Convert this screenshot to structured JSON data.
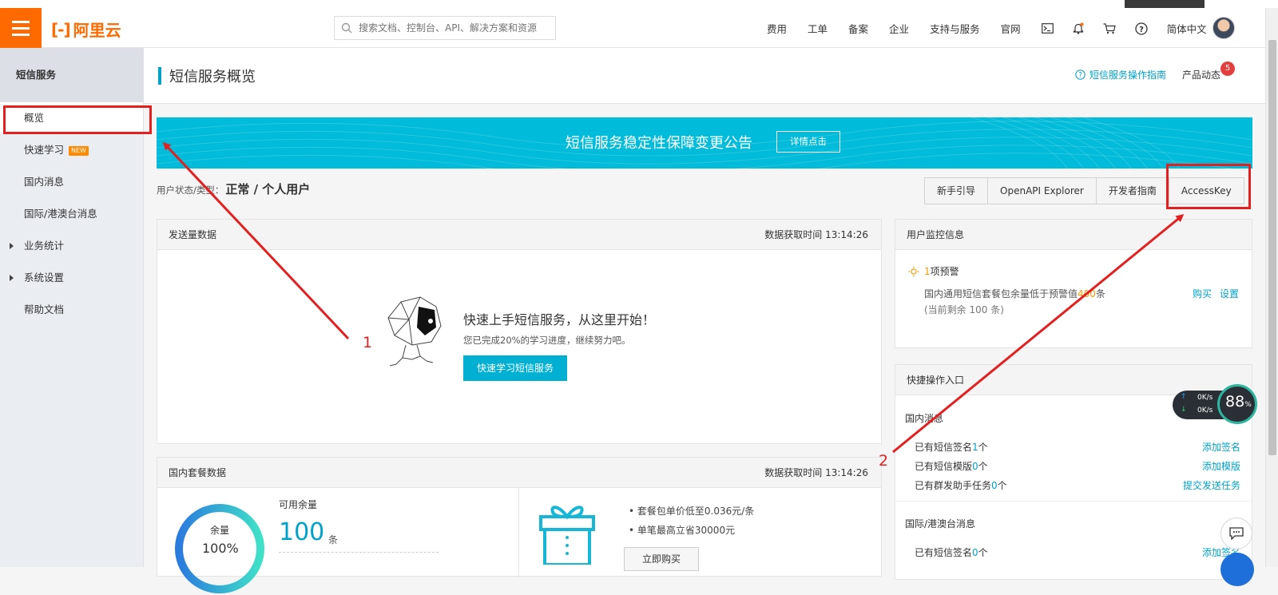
{
  "top": {
    "logo_text": "阿里云",
    "search_placeholder": "搜索文档、控制台、API、解决方案和资源",
    "nav": [
      "费用",
      "工单",
      "备案",
      "企业",
      "支持与服务",
      "官网"
    ],
    "lang": "简体中文"
  },
  "sidebar": {
    "title": "短信服务",
    "items": [
      {
        "label": "概览",
        "active": true
      },
      {
        "label": "快速学习",
        "badge": "NEW"
      },
      {
        "label": "国内消息"
      },
      {
        "label": "国际/港澳台消息"
      },
      {
        "label": "业务统计",
        "expandable": true
      },
      {
        "label": "系统设置",
        "expandable": true
      },
      {
        "label": "帮助文档"
      }
    ]
  },
  "header": {
    "title": "短信服务概览",
    "guide_link": "短信服务操作指南",
    "news_label": "产品动态",
    "news_count": "5"
  },
  "banner": {
    "text": "短信服务稳定性保障变更公告",
    "button": "详情点击"
  },
  "user_status": {
    "label": "用户状态/类型：",
    "value": "正常 / 个人用户"
  },
  "toolbar": [
    "新手引导",
    "OpenAPI Explorer",
    "开发者指南",
    "AccessKey"
  ],
  "send_panel": {
    "title": "发送量数据",
    "time": "数据获取时间 13:14:26",
    "promo_title": "快速上手短信服务，从这里开始！",
    "promo_sub": "您已完成20%的学习进度，继续努力吧。",
    "promo_button": "快速学习短信服务"
  },
  "package_panel": {
    "title": "国内套餐数据",
    "time": "数据获取时间 13:14:26",
    "ring_label": "余量",
    "ring_value": "100%",
    "avail_label": "可用余量",
    "avail_value": "100",
    "avail_unit": "条",
    "bullets": [
      "套餐包单价低至0.036元/条",
      "单笔最高立省30000元"
    ],
    "buy_button": "立即购买"
  },
  "monitor_panel": {
    "title": "用户监控信息",
    "warn_count": "1",
    "warn_text": "项预警",
    "desc_pre": "国内通用短信套餐包余量低于预警值",
    "desc_num": "400",
    "desc_post": "条",
    "remaining": "(当前剩余 100 条)",
    "link_buy": "购买",
    "link_set": "设置"
  },
  "quick_panel": {
    "title": "快捷操作入口",
    "domestic_label": "国内消息",
    "domestic_rows": [
      {
        "pre": "已有短信签名",
        "n": "1",
        "post": "个",
        "link": "添加签名"
      },
      {
        "pre": "已有短信模版",
        "n": "0",
        "post": "个",
        "link": "添加模版"
      },
      {
        "pre": "已有群发助手任务",
        "n": "0",
        "post": "个",
        "link": "提交发送任务"
      }
    ],
    "intl_label": "国际/港澳台消息",
    "intl_rows": [
      {
        "pre": "已有短信签名",
        "n": "0",
        "post": "个",
        "link": "添加签名"
      }
    ]
  },
  "annotations": {
    "one": "1",
    "two": "2"
  },
  "speed_widget": {
    "up": "0K/s",
    "down": "0K/s",
    "percent": "88",
    "percent_sign": "%"
  },
  "colors": {
    "orange": "#ff6a00",
    "accent": "#00a2ca",
    "banner": "#00bbd9",
    "annotation": "#e31f1f"
  }
}
